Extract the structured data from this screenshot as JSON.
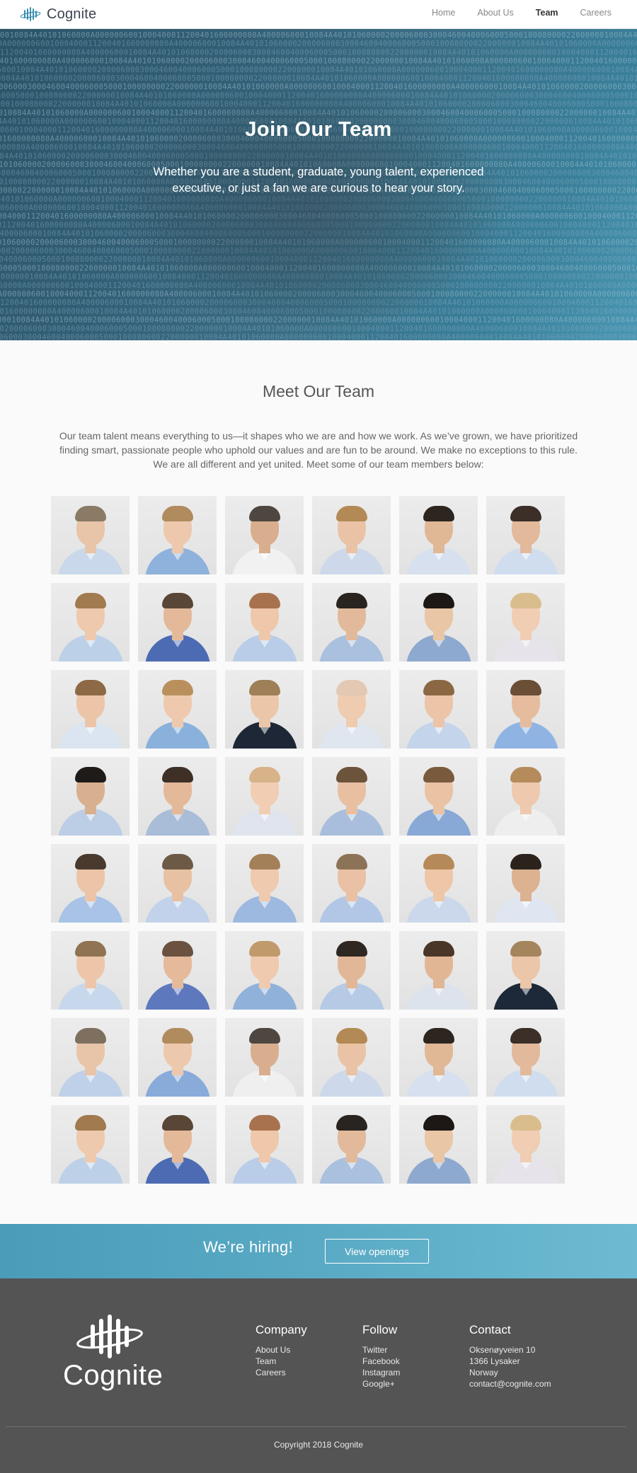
{
  "nav": {
    "brand": "Cognite",
    "links": [
      {
        "label": "Home",
        "active": false
      },
      {
        "label": "About Us",
        "active": false
      },
      {
        "label": "Team",
        "active": true
      },
      {
        "label": "Careers",
        "active": false
      }
    ]
  },
  "hero": {
    "title": "Join Our Team",
    "subtitle": "Whether you are a student, graduate, young talent, experienced executive, or just a fan we are curious to hear your story."
  },
  "team": {
    "title": "Meet Our Team",
    "intro": "Our team talent means everything to us—it shapes who we are and how we work. As we’ve grown, we have prioritized finding smart, passionate people who uphold our values and are fun to be around. We make no exceptions to this rule. We are all different and yet united. Meet some of our team members below:",
    "photos": [
      {
        "shirt": "#c9d8ea",
        "hair": "#8a7a66",
        "skin": "#e8c4a8"
      },
      {
        "shirt": "#8fb2dc",
        "hair": "#b08b5e",
        "skin": "#edc8ad"
      },
      {
        "shirt": "#f1f1f1",
        "hair": "#4e4640",
        "skin": "#d9ae8e"
      },
      {
        "shirt": "#cdd9ea",
        "hair": "#b38a55",
        "skin": "#eac3a6"
      },
      {
        "shirt": "#d6e0ee",
        "hair": "#2d2620",
        "skin": "#e0b896"
      },
      {
        "shirt": "#d0ddef",
        "hair": "#3b2f27",
        "skin": "#e3b99b"
      },
      {
        "shirt": "#bcd0e8",
        "hair": "#a17a50",
        "skin": "#eec9ad"
      },
      {
        "shirt": "#4d6bb3",
        "hair": "#5a4636",
        "skin": "#e4b99a"
      },
      {
        "shirt": "#b9cde8",
        "hair": "#a8724e",
        "skin": "#efc7aa"
      },
      {
        "shirt": "#a9c0de",
        "hair": "#2a2420",
        "skin": "#e2ba9b"
      },
      {
        "shirt": "#8ea9cf",
        "hair": "#1d1815",
        "skin": "#e9c6a5"
      },
      {
        "shirt": "#e7e3ea",
        "hair": "#d9bd8c",
        "skin": "#f0cdb3"
      },
      {
        "shirt": "#dbe5f1",
        "hair": "#8d6a45",
        "skin": "#ecc5a9"
      },
      {
        "shirt": "#8ab0dc",
        "hair": "#b98f5c",
        "skin": "#eec9ad"
      },
      {
        "shirt": "#1d2736",
        "hair": "#9e7f58",
        "skin": "#ecc6a8"
      },
      {
        "shirt": "#dfe6ef",
        "hair": "#e3c8b3",
        "skin": "#efcbb0"
      },
      {
        "shirt": "#c4d4ea",
        "hair": "#8b6744",
        "skin": "#ecc4a7"
      },
      {
        "shirt": "#8fb4e4",
        "hair": "#6a4e36",
        "skin": "#e6bc9e"
      },
      {
        "shirt": "#bccee6",
        "hair": "#1e1b19",
        "skin": "#d9b08f"
      },
      {
        "shirt": "#a9bcd8",
        "hair": "#3e3027",
        "skin": "#e3b99a"
      },
      {
        "shirt": "#dfe4ee",
        "hair": "#d8b38a",
        "skin": "#f1cdb3"
      },
      {
        "shirt": "#a9bedc",
        "hair": "#6c533c",
        "skin": "#e8bfa1"
      },
      {
        "shirt": "#88a8d6",
        "hair": "#7a5a3c",
        "skin": "#eac2a4"
      },
      {
        "shirt": "#eeeeee",
        "hair": "#b58b5c",
        "skin": "#efc9ad"
      },
      {
        "shirt": "#a8c3e6",
        "hair": "#4a3a2e",
        "skin": "#ecc4a7"
      },
      {
        "shirt": "#c2d2ea",
        "hair": "#6d5a46",
        "skin": "#e8c0a2"
      },
      {
        "shirt": "#9db9e0",
        "hair": "#a48058",
        "skin": "#efcaae"
      },
      {
        "shirt": "#b2c7e6",
        "hair": "#8c7358",
        "skin": "#eac1a4"
      },
      {
        "shirt": "#cbd8eb",
        "hair": "#b58a58",
        "skin": "#eec6a8"
      },
      {
        "shirt": "#dfe6f1",
        "hair": "#2b221c",
        "skin": "#dcb291"
      },
      {
        "shirt": "#c8d8ec",
        "hair": "#8f7352",
        "skin": "#edc6a9"
      },
      {
        "shirt": "#5d78bd",
        "hair": "#6a5140",
        "skin": "#e4ba9b"
      },
      {
        "shirt": "#90b1da",
        "hair": "#c19a6b",
        "skin": "#efcaae"
      },
      {
        "shirt": "#b6cae6",
        "hair": "#2e2722",
        "skin": "#e1b797"
      },
      {
        "shirt": "#dde3ec",
        "hair": "#4a3628",
        "skin": "#e1b695"
      },
      {
        "shirt": "#1d2838",
        "hair": "#a5855c",
        "skin": "#ecc6a8"
      },
      {
        "shirt": "#bfd1e9",
        "hair": "#7e6f5e",
        "skin": "#e8c4a8"
      },
      {
        "shirt": "#89abda",
        "hair": "#b08b5e",
        "skin": "#edc8ad"
      },
      {
        "shirt": "#efefef",
        "hair": "#4e4640",
        "skin": "#d9ae8e"
      },
      {
        "shirt": "#cdd9ea",
        "hair": "#b38a55",
        "skin": "#eac3a6"
      },
      {
        "shirt": "#d6e0ee",
        "hair": "#2d2620",
        "skin": "#e0b896"
      },
      {
        "shirt": "#d0ddef",
        "hair": "#3b2f27",
        "skin": "#e3b99b"
      },
      {
        "shirt": "#bcd0e8",
        "hair": "#a17a50",
        "skin": "#eec9ad"
      },
      {
        "shirt": "#4d6bb3",
        "hair": "#5a4636",
        "skin": "#e4b99a"
      },
      {
        "shirt": "#b9cde8",
        "hair": "#a8724e",
        "skin": "#efc7aa"
      },
      {
        "shirt": "#a9c0de",
        "hair": "#2a2420",
        "skin": "#e2ba9b"
      },
      {
        "shirt": "#8ea9cf",
        "hair": "#1d1815",
        "skin": "#e9c6a5"
      },
      {
        "shirt": "#e7e3ea",
        "hair": "#d9bd8c",
        "skin": "#f0cdb3"
      }
    ]
  },
  "hiring": {
    "text": "We’re hiring!",
    "button": "View openings"
  },
  "footer": {
    "logo_text": "Cognite",
    "company": {
      "title": "Company",
      "links": [
        "About Us",
        "Team",
        "Careers"
      ]
    },
    "follow": {
      "title": "Follow",
      "links": [
        "Twitter",
        "Facebook",
        "Instagram",
        "Google+"
      ]
    },
    "contact": {
      "title": "Contact",
      "lines": [
        "Oksenøyveien 10",
        "1366 Lysaker",
        "Norway",
        "contact@cognite.com"
      ]
    },
    "copyright": "Copyright 2018 Cognite"
  },
  "colors": {
    "accent": "#4a9cb9",
    "hero_teal": "#3a7f99",
    "footer_bg": "#545454"
  }
}
